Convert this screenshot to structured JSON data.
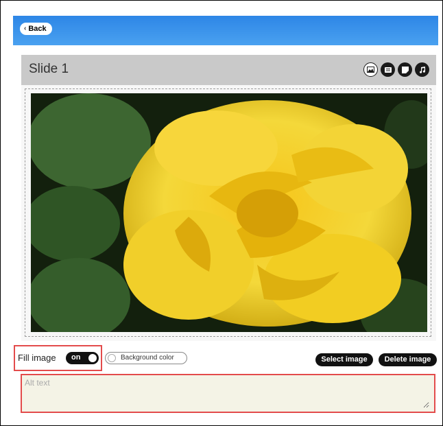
{
  "topbar": {
    "back_label": "Back"
  },
  "slide": {
    "title": "Slide 1",
    "header_icons": [
      "image-icon",
      "text-box-icon",
      "sticky-note-icon",
      "music-note-icon"
    ]
  },
  "photo": {
    "subject": "yellow-rose"
  },
  "controls": {
    "fill_image_label": "Fill image",
    "fill_toggle_state": "on",
    "background_color_label": "Background color",
    "select_image_label": "Select image",
    "delete_image_label": "Delete image"
  },
  "alt_text": {
    "placeholder": "Alt text",
    "value": ""
  },
  "colors": {
    "topbar": "#3b93ea",
    "highlight": "#e34b4b",
    "alt_bg": "#f4f3e6",
    "pill": "#111111"
  }
}
